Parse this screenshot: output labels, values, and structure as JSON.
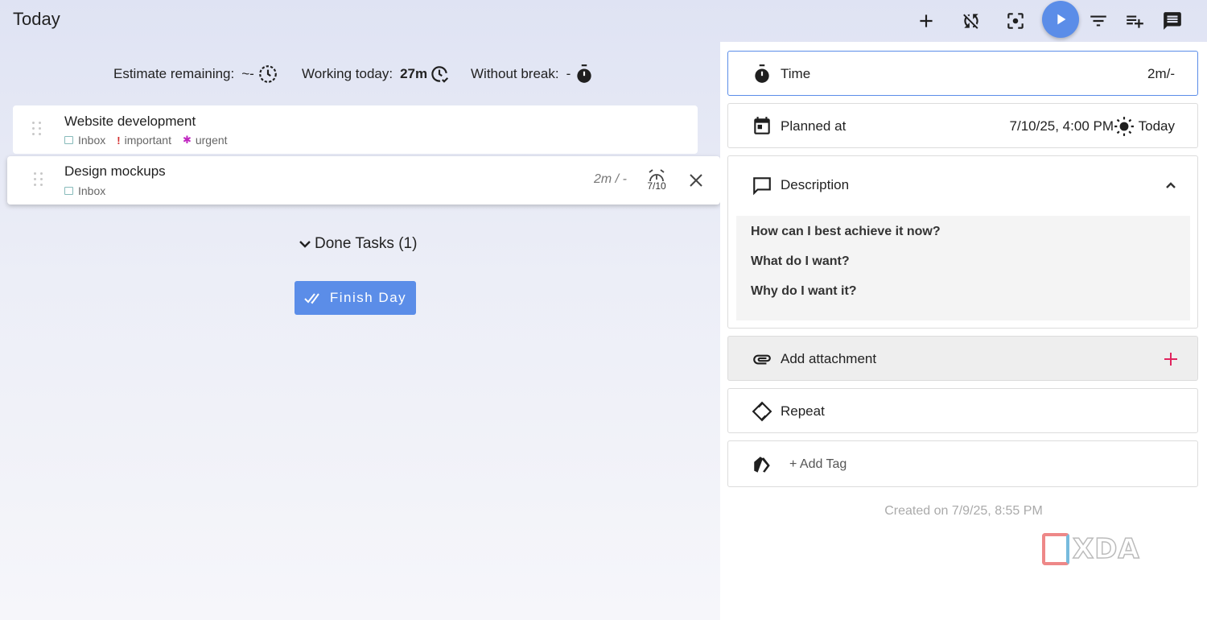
{
  "header": {
    "title": "Today"
  },
  "stats": {
    "estimate_label": "Estimate remaining:",
    "estimate_value": "~-",
    "working_label": "Working today:",
    "working_value": "27m",
    "break_label": "Without break:",
    "break_value": "-"
  },
  "tasks": [
    {
      "title": "Website development",
      "tags": [
        {
          "label": "Inbox",
          "icon": "inbox-icon"
        },
        {
          "label": "important",
          "icon": "exclamation-icon",
          "color": "#d32f2f"
        },
        {
          "label": "urgent",
          "icon": "asterisk-icon",
          "color": "#c026c0"
        }
      ]
    },
    {
      "title": "Design mockups",
      "tags": [
        {
          "label": "Inbox",
          "icon": "inbox-icon"
        }
      ],
      "estimate": "2m / -",
      "due": "7/10"
    }
  ],
  "done_tasks_label": "Done Tasks (1)",
  "finish_day_label": "Finish Day",
  "panel": {
    "time": {
      "label": "Time",
      "value": "2m/-"
    },
    "planned": {
      "label": "Planned at",
      "value": "7/10/25, 4:00 PM",
      "today_label": "Today"
    },
    "description": {
      "label": "Description",
      "lines": [
        "How can I best achieve it now?",
        "What do I want?",
        "Why do I want it?"
      ]
    },
    "attachment": {
      "label": "Add attachment"
    },
    "repeat": {
      "label": "Repeat"
    },
    "tag": {
      "label": "+ Add Tag"
    },
    "created": "Created on 7/9/25, 8:55 PM"
  },
  "colors": {
    "accent": "#5b8de8",
    "attach_plus": "#e0245e"
  }
}
